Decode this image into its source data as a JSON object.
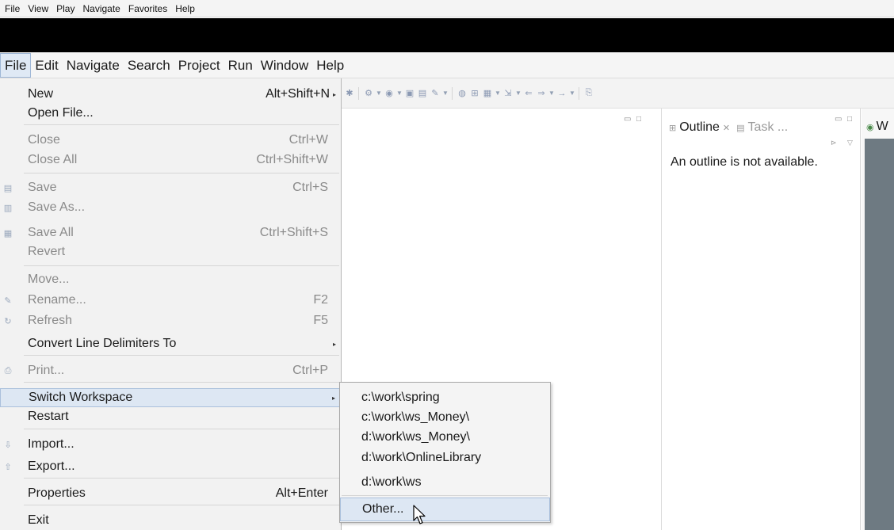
{
  "player_menu": [
    "File",
    "View",
    "Play",
    "Navigate",
    "Favorites",
    "Help"
  ],
  "eclipse_menu": [
    "File",
    "Edit",
    "Navigate",
    "Search",
    "Project",
    "Run",
    "Window",
    "Help"
  ],
  "file_menu": {
    "items": [
      {
        "label": "New",
        "shortcut": "Alt+Shift+N",
        "submenu": true,
        "enabled": true,
        "icon": ""
      },
      {
        "label": "Open File...",
        "shortcut": "",
        "submenu": false,
        "enabled": true,
        "icon": ""
      },
      {
        "label": "Close",
        "shortcut": "Ctrl+W",
        "submenu": false,
        "enabled": false,
        "icon": ""
      },
      {
        "label": "Close All",
        "shortcut": "Ctrl+Shift+W",
        "submenu": false,
        "enabled": false,
        "icon": ""
      },
      {
        "label": "Save",
        "shortcut": "Ctrl+S",
        "submenu": false,
        "enabled": false,
        "icon": "save-icon"
      },
      {
        "label": "Save As...",
        "shortcut": "",
        "submenu": false,
        "enabled": false,
        "icon": "save-as-icon"
      },
      {
        "label": "Save All",
        "shortcut": "Ctrl+Shift+S",
        "submenu": false,
        "enabled": false,
        "icon": "save-all-icon"
      },
      {
        "label": "Revert",
        "shortcut": "",
        "submenu": false,
        "enabled": false,
        "icon": ""
      },
      {
        "label": "Move...",
        "shortcut": "",
        "submenu": false,
        "enabled": false,
        "icon": ""
      },
      {
        "label": "Rename...",
        "shortcut": "F2",
        "submenu": false,
        "enabled": false,
        "icon": "rename-icon"
      },
      {
        "label": "Refresh",
        "shortcut": "F5",
        "submenu": false,
        "enabled": false,
        "icon": "refresh-icon"
      },
      {
        "label": "Convert Line Delimiters To",
        "shortcut": "",
        "submenu": true,
        "enabled": true,
        "icon": ""
      },
      {
        "label": "Print...",
        "shortcut": "Ctrl+P",
        "submenu": false,
        "enabled": false,
        "icon": "print-icon"
      },
      {
        "label": "Switch Workspace",
        "shortcut": "",
        "submenu": true,
        "enabled": true,
        "icon": "",
        "highlighted": true
      },
      {
        "label": "Restart",
        "shortcut": "",
        "submenu": false,
        "enabled": true,
        "icon": ""
      },
      {
        "label": "Import...",
        "shortcut": "",
        "submenu": false,
        "enabled": true,
        "icon": "import-icon"
      },
      {
        "label": "Export...",
        "shortcut": "",
        "submenu": false,
        "enabled": true,
        "icon": "export-icon"
      },
      {
        "label": "Properties",
        "shortcut": "Alt+Enter",
        "submenu": false,
        "enabled": true,
        "icon": ""
      },
      {
        "label": "Exit",
        "shortcut": "",
        "submenu": false,
        "enabled": true,
        "icon": ""
      }
    ]
  },
  "workspace_menu": {
    "recent": [
      "c:\\work\\spring",
      "c:\\work\\ws_Money\\",
      "d:\\work\\ws_Money\\",
      "d:\\work\\OnlineLibrary",
      "d:\\work\\ws"
    ],
    "other": "Other..."
  },
  "outline": {
    "tab_active": "Outline",
    "tab_inactive": "Task ...",
    "message": "An outline is not available."
  },
  "right_view": {
    "tab_label": "W"
  }
}
